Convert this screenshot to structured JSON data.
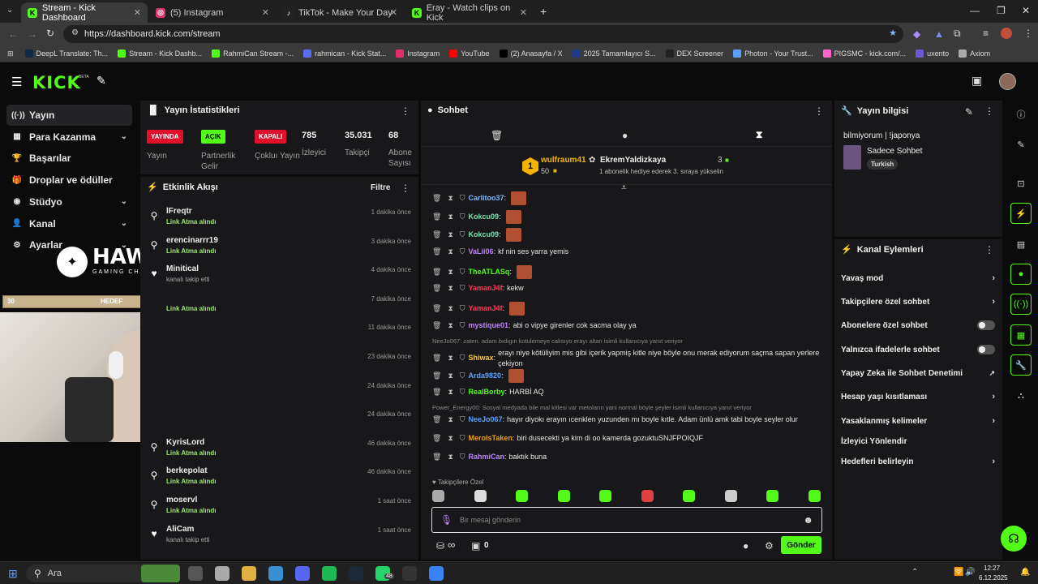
{
  "browser": {
    "tabs": [
      {
        "label": "Stream - Kick Dashboard",
        "color": "#53fc18",
        "letter": "K"
      },
      {
        "label": "(5) Instagram",
        "color": "#e1306c",
        "letter": "◎"
      },
      {
        "label": "TikTok - Make Your Day",
        "color": "#ffffff",
        "letter": "♪"
      },
      {
        "label": "Eray - Watch clips on Kick",
        "color": "#53fc18",
        "letter": "K"
      }
    ],
    "new_tab": "+",
    "url": "https://dashboard.kick.com/stream",
    "bookmarks": [
      {
        "label": "DeepL Translate: Th...",
        "color": "#0f2b46"
      },
      {
        "label": "Stream - Kick Dashb...",
        "color": "#53fc18"
      },
      {
        "label": "RahmiCan Stream -...",
        "color": "#53fc18"
      },
      {
        "label": "rahmican - Kick Stat...",
        "color": "#5a6cf0"
      },
      {
        "label": "Instagram",
        "color": "#e1306c"
      },
      {
        "label": "YouTube",
        "color": "#ff0000"
      },
      {
        "label": "(2) Anasayfa / X",
        "color": "#000000"
      },
      {
        "label": "2025 Tamamlayıcı S...",
        "color": "#1e3a8a"
      },
      {
        "label": "DEX Screener",
        "color": "#222222"
      },
      {
        "label": "Photon - Your Trust...",
        "color": "#5aa0ff"
      },
      {
        "label": "PIGSMC - kick.com/...",
        "color": "#ff66cc"
      },
      {
        "label": "uxento",
        "color": "#6a5acd"
      },
      {
        "label": "Axiom",
        "color": "#aaaaaa"
      }
    ]
  },
  "kick": {
    "logo": "KICK",
    "beta": "BETA"
  },
  "sidebar": {
    "items": [
      {
        "label": "Yayın",
        "icon": "((·))",
        "chevron": ""
      },
      {
        "label": "Para Kazanma",
        "icon": "▦",
        "chevron": "⌄"
      },
      {
        "label": "Başarılar",
        "icon": "🏆",
        "chevron": ""
      },
      {
        "label": "Droplar ve ödüller",
        "icon": "🎁",
        "chevron": ""
      },
      {
        "label": "Stüdyo",
        "icon": "◉",
        "chevron": "⌄"
      },
      {
        "label": "Kanal",
        "icon": "👤",
        "chevron": "⌄"
      },
      {
        "label": "Ayarlar",
        "icon": "⚙",
        "chevron": "⌄"
      }
    ]
  },
  "overlay": {
    "hawk_title": "HAWK",
    "hawk_sub": "GAMING CHAIR",
    "goal_left": "30",
    "goal_label": "HEDEF",
    "goal_right": "5"
  },
  "stats": {
    "title": "Yayın İstatistikleri",
    "badges": [
      {
        "text": "YAYINDA",
        "label": "Yayın",
        "bg": "#e0102a",
        "fg": "#ffffff"
      },
      {
        "text": "AÇIK",
        "label": "Partnerlik Gelir",
        "bg": "#53fc18",
        "fg": "#000000"
      },
      {
        "text": "KAPALI",
        "label": "Çokluı Yayın",
        "bg": "#e0102a",
        "fg": "#ffffff"
      }
    ],
    "numbers": [
      {
        "value": "785",
        "label": "İzleyici"
      },
      {
        "value": "35.031",
        "label": "Takipçi"
      },
      {
        "value": "68",
        "label": "Abone Sayısı"
      }
    ]
  },
  "activity": {
    "title": "Etkinlik Akışı",
    "filter": "Filtre",
    "items": [
      {
        "name": "lFreqtr",
        "desc": "Link Atma alındı",
        "time": "1 dakika önce",
        "icon": "⚲",
        "type": "link"
      },
      {
        "name": "erencinarrr19",
        "desc": "Link Atma alındı",
        "time": "3 dakika önce",
        "icon": "⚲",
        "type": "link"
      },
      {
        "name": "Minitical",
        "desc": "kanalı takip etti",
        "time": "4 dakika önce",
        "icon": "♥",
        "type": "follow"
      },
      {
        "name": "",
        "desc": "Link Atma alındı",
        "time": "7 dakika önce",
        "icon": "",
        "type": "link"
      },
      {
        "name": "",
        "desc": "",
        "time": "11 dakika önce",
        "icon": "",
        "type": "link"
      },
      {
        "name": "",
        "desc": "",
        "time": "23 dakika önce",
        "icon": "",
        "type": "link"
      },
      {
        "name": "",
        "desc": "",
        "time": "24 dakika önce",
        "icon": "",
        "type": "link"
      },
      {
        "name": "",
        "desc": "",
        "time": "24 dakika önce",
        "icon": "",
        "type": "link"
      },
      {
        "name": "KyrisLord",
        "desc": "Link Atma alındı",
        "time": "46 dakika önce",
        "icon": "⚲",
        "type": "link"
      },
      {
        "name": "berkepolat",
        "desc": "Link Atma alındı",
        "time": "46 dakika önce",
        "icon": "⚲",
        "type": "link"
      },
      {
        "name": "moservl",
        "desc": "Link Atma alındı",
        "time": "1 saat önce",
        "icon": "⚲",
        "type": "link"
      },
      {
        "name": "AliCam",
        "desc": "kanalı takip etti",
        "time": "1 saat önce",
        "icon": "♥",
        "type": "follow"
      }
    ]
  },
  "chat": {
    "title": "Sohbet",
    "pinned": {
      "rank": "1",
      "user": "wulfraum41",
      "count": "50",
      "gifter": "EkremYaldizkaya",
      "gift_count": "3",
      "gift_desc": "1 abonelik hediye ederek 3. sıraya yükselin"
    },
    "messages": [
      {
        "user": "Carlitoo37",
        "color": "#7eb6ff",
        "text": "",
        "emote": true,
        "reply": ""
      },
      {
        "user": "Kokcu09",
        "color": "#7ee0b0",
        "text": "",
        "emote": true,
        "reply": ""
      },
      {
        "user": "Kokcu09",
        "color": "#7ee0b0",
        "text": "",
        "emote": true,
        "reply": ""
      },
      {
        "user": "VaLii06",
        "color": "#c084fc",
        "text": "kf nin ses yarra yemis",
        "emote": false,
        "reply": ""
      },
      {
        "user": "TheATLASq",
        "color": "#53fc18",
        "text": "",
        "emote": true,
        "reply": ""
      },
      {
        "user": "YamanJ4f",
        "color": "#ff3b5c",
        "text": "kekw",
        "emote": false,
        "reply": ""
      },
      {
        "user": "YamanJ4f",
        "color": "#ff3b5c",
        "text": "",
        "emote": true,
        "reply": ""
      },
      {
        "user": "mystique01",
        "color": "#c084fc",
        "text": "abi o vipye girenler cok sacma olay ya",
        "emote": false,
        "reply": ""
      },
      {
        "user": "Shiwax",
        "color": "#f5c542",
        "text": "erayı niye kötüliyim mis gibi içerik yapmiş kitle niye böyle onu merak ediyorum saçma sapan yerlere çekiyon",
        "emote": false,
        "reply": "NeeJo067: zaten. adam bıdıgın kotulemeye calısıyo erayı altan isimli kullanıcıya yanıt veriyor"
      },
      {
        "user": "Arda9820",
        "color": "#5aa0ff",
        "text": "",
        "emote": true,
        "reply": ""
      },
      {
        "user": "RealBorby",
        "color": "#53fc18",
        "text": "HARBİ AQ",
        "emote": false,
        "reply": ""
      },
      {
        "user": "NeeJo067",
        "color": "#5aa0ff",
        "text": "hayır diyokı erayın ıcenklen yuzunden mı boyle kıtle. Adam ünlü amk tabi boyle seyler olur",
        "emote": false,
        "reply": "Power_Energy00: Sosyal medyada bile mal kitlesi var metoların yani normal böyle şeyler isimli kullanıcıya yanıt veriyor"
      },
      {
        "user": "MerolsTaken",
        "color": "#f59e0b",
        "text": "biri dusecekti ya kim di oo kamerda gozuktuSNJFPOIQJF",
        "emote": false,
        "reply": ""
      },
      {
        "user": "RahmiCan",
        "color": "#c084fc",
        "text": "baktık buna",
        "emote": false,
        "reply": ""
      }
    ],
    "followers_only": "Takipçilere Özel",
    "placeholder": "Bir mesaj gönderin",
    "infinity": "∞",
    "zero": "0",
    "send": "Gönder"
  },
  "info": {
    "title": "Yayın bilgisi",
    "stream_title": "bilmiyorum | !japonya",
    "category": "Sadece Sohbet",
    "language": "Turkish"
  },
  "actions": {
    "title": "Kanal Eylemleri",
    "rows": [
      {
        "label": "Yavaş mod",
        "kind": "chevron"
      },
      {
        "label": "Takipçilere özel sohbet",
        "kind": "chevron"
      },
      {
        "label": "Abonelere özel sohbet",
        "kind": "toggle"
      },
      {
        "label": "Yalnızca ifadelerle sohbet",
        "kind": "toggle"
      },
      {
        "label": "Yapay Zeka ile Sohbet Denetimi",
        "kind": "external"
      },
      {
        "label": "Hesap yaşı kısıtlaması",
        "kind": "chevron"
      },
      {
        "label": "Yasaklanmış kelimeler",
        "kind": "chevron"
      },
      {
        "label": "İzleyici Yönlendir",
        "kind": "none"
      },
      {
        "label": "Hedefleri belirleyin",
        "kind": "chevron"
      }
    ]
  },
  "taskbar": {
    "search": "Ara",
    "time": "12:27",
    "date": "6.12.2025",
    "whatsapp_badge": "48"
  }
}
